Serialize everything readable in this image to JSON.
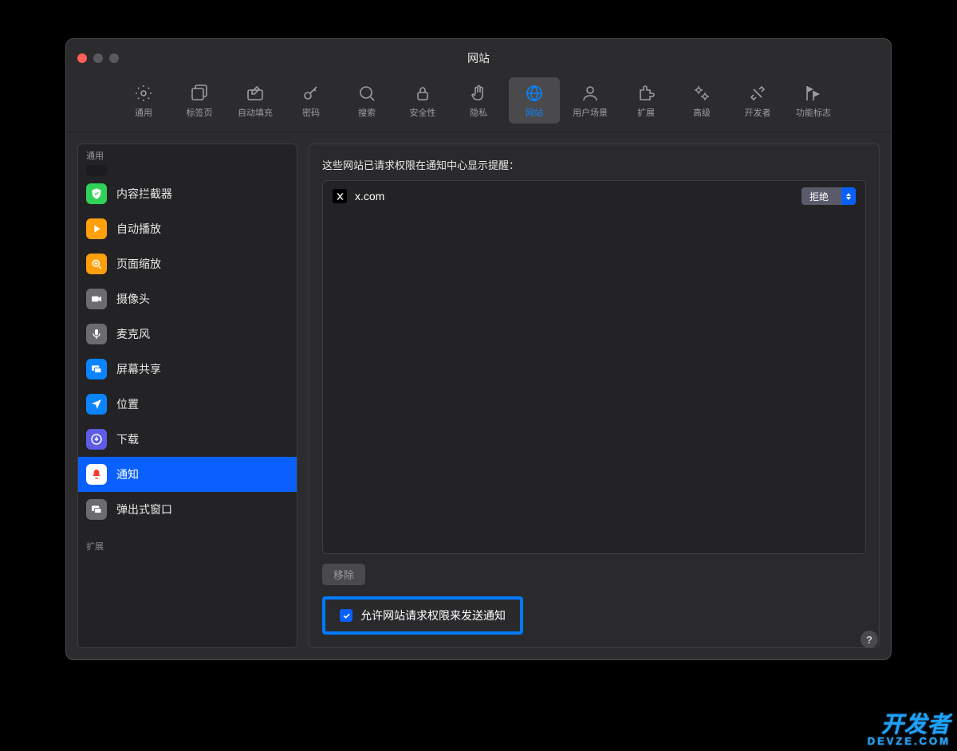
{
  "window": {
    "title": "网站"
  },
  "tabs": [
    {
      "id": "general",
      "label": "通用",
      "icon": "gear-icon"
    },
    {
      "id": "tabs",
      "label": "标签页",
      "icon": "tabs-icon"
    },
    {
      "id": "autofill",
      "label": "自动填充",
      "icon": "pencil-box-icon"
    },
    {
      "id": "passwords",
      "label": "密码",
      "icon": "key-icon"
    },
    {
      "id": "search",
      "label": "搜索",
      "icon": "search-icon"
    },
    {
      "id": "security",
      "label": "安全性",
      "icon": "lock-icon"
    },
    {
      "id": "privacy",
      "label": "隐私",
      "icon": "hand-icon"
    },
    {
      "id": "websites",
      "label": "网站",
      "icon": "globe-icon",
      "selected": true
    },
    {
      "id": "profiles",
      "label": "用户场景",
      "icon": "person-icon"
    },
    {
      "id": "extensions",
      "label": "扩展",
      "icon": "puzzle-icon"
    },
    {
      "id": "advanced",
      "label": "高级",
      "icon": "gears-icon"
    },
    {
      "id": "developer",
      "label": "开发者",
      "icon": "wrench-icon"
    },
    {
      "id": "flags",
      "label": "功能标志",
      "icon": "flags-icon"
    }
  ],
  "sidebar": {
    "header": "通用",
    "items": [
      {
        "id": "blockers",
        "label": "内容拦截器",
        "icon": "shield-check-icon",
        "bg": "#30d158"
      },
      {
        "id": "autoplay",
        "label": "自动播放",
        "icon": "play-icon",
        "bg": "#ff9f0a"
      },
      {
        "id": "zoom",
        "label": "页面缩放",
        "icon": "zoom-icon",
        "bg": "#ff9f0a"
      },
      {
        "id": "camera",
        "label": "摄像头",
        "icon": "camera-icon",
        "bg": "#6c6c70"
      },
      {
        "id": "mic",
        "label": "麦克风",
        "icon": "mic-icon",
        "bg": "#6c6c70"
      },
      {
        "id": "screen",
        "label": "屏幕共享",
        "icon": "screen-share-icon",
        "bg": "#0a84ff"
      },
      {
        "id": "location",
        "label": "位置",
        "icon": "location-icon",
        "bg": "#0a84ff"
      },
      {
        "id": "downloads",
        "label": "下载",
        "icon": "download-icon",
        "bg": "#5e5ce6"
      },
      {
        "id": "notify",
        "label": "通知",
        "icon": "bell-icon",
        "bg": "#ffffff",
        "fg": "#ff3b30",
        "selected": true
      },
      {
        "id": "popups",
        "label": "弹出式窗口",
        "icon": "window-icon",
        "bg": "#6c6c70"
      }
    ],
    "sections": [
      {
        "label": "扩展"
      }
    ]
  },
  "main": {
    "description": "这些网站已请求权限在通知中心显示提醒：",
    "sites": [
      {
        "favicon": "x-icon",
        "domain": "x.com",
        "action": "拒绝"
      }
    ],
    "remove_button": "移除",
    "allow_checkbox": {
      "checked": true,
      "label": "允许网站请求权限来发送通知"
    }
  },
  "help_button": "?",
  "watermark": {
    "line1": "开发者",
    "line2": "DEVZE.COM"
  }
}
